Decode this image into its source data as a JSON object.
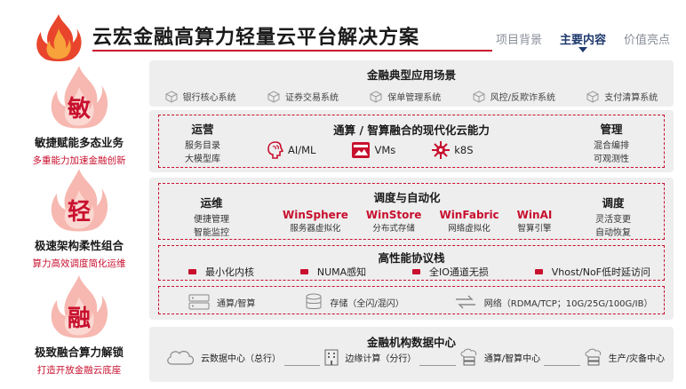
{
  "header": {
    "title": "云宏金融高算力轻量云平台解决方案",
    "nav": [
      "项目背景",
      "主要内容",
      "价值亮点"
    ],
    "active_nav": 1
  },
  "pillars": [
    {
      "char": "敏",
      "title": "敏捷赋能多态业务",
      "subtitle": "多重能力加速金融创新"
    },
    {
      "char": "轻",
      "title": "极速架构柔性组合",
      "subtitle": "算力高效调度简化运维"
    },
    {
      "char": "融",
      "title": "极致融合算力解锁",
      "subtitle": "打造开放金融云底座"
    }
  ],
  "scenarios": {
    "title": "金融典型应用场景",
    "items": [
      "银行核心系统",
      "证券交易系统",
      "保单管理系统",
      "风控/反欺诈系统",
      "支付清算系统"
    ]
  },
  "capability": {
    "left_title": "运营",
    "left_items": [
      "服务目录",
      "大模型库"
    ],
    "center_title": "通算 / 智算融合的现代化云能力",
    "tech": [
      "AI/ML",
      "VMs",
      "k8S"
    ],
    "right_title": "管理",
    "right_items": [
      "混合编排",
      "可观测性"
    ]
  },
  "scheduling": {
    "left_title": "运维",
    "left_items": [
      "便捷管理",
      "智能监控"
    ],
    "center_title": "调度与自动化",
    "products": [
      {
        "name": "WinSphere",
        "desc": "服务器虚拟化"
      },
      {
        "name": "WinStore",
        "desc": "分布式存储"
      },
      {
        "name": "WinFabric",
        "desc": "网络虚拟化"
      },
      {
        "name": "WinAI",
        "desc": "智算引擎"
      }
    ],
    "right_title": "调度",
    "right_items": [
      "灵活变更",
      "自动恢复"
    ]
  },
  "protocol": {
    "title": "高性能协议栈",
    "items": [
      "最小化内核",
      "NUMA感知",
      "全IO通道无损",
      "Vhost/NoF低时延访问"
    ]
  },
  "infra": {
    "items": [
      "通算/智算",
      "存储（全闪/混闪）",
      "网络（RDMA/TCP；10G/25G/100G/IB）"
    ]
  },
  "datacenter": {
    "title": "金融机构数据中心",
    "items": [
      "云数据中心（总行）",
      "边缘计算（分行）",
      "通算/智算中心",
      "生产/灾备中心"
    ]
  },
  "colors": {
    "accent": "#c8102e",
    "nav_active": "#1f3a6e",
    "panel_bg": "#eeeeee"
  }
}
